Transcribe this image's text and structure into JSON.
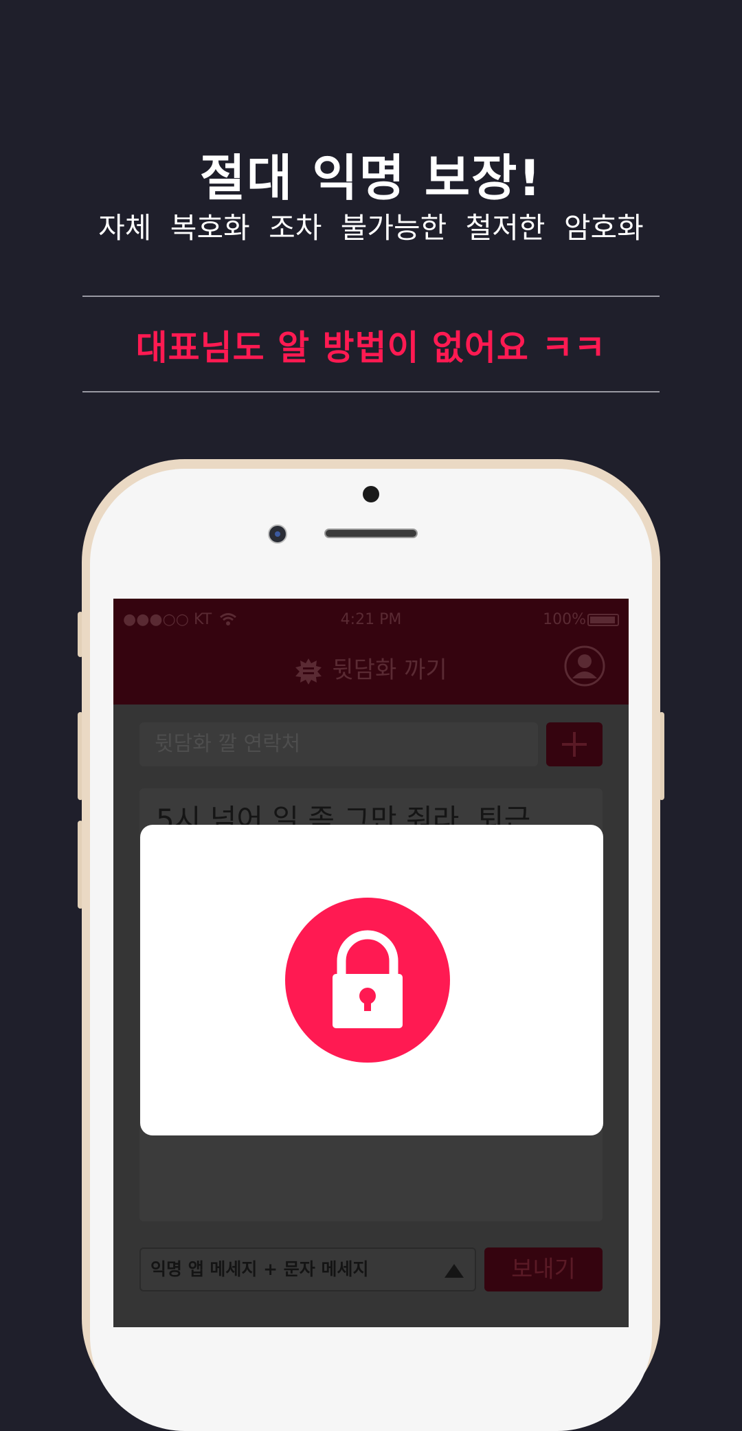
{
  "promo": {
    "headline": "절대 익명 보장!",
    "subheadline": "자체 복호화 조차 불가능한 철저한 암호화",
    "highlight": "대표님도 알 방법이 없어요 ㅋㅋ",
    "accent_color": "#ff1a52",
    "background_color": "#1f1f2b"
  },
  "status_bar": {
    "signal": "●●●○○ KT",
    "time": "4:21 PM",
    "battery": "100%"
  },
  "app_bar": {
    "title": "뒷담화 까기",
    "logo_icon": "speech-burst-logo-icon",
    "profile_icon": "profile-icon",
    "color": "#35040f"
  },
  "compose": {
    "contact_placeholder": "뒷담화 깔 연락처",
    "add_icon": "plus-icon",
    "message_text": "5시 넘어 일 좀 그만 줘라. 퇴근",
    "send_mode": "익명 앱 메세지 + 문자 메세지",
    "send_label": "보내기"
  },
  "modal": {
    "icon": "unlocked-padlock-icon"
  }
}
